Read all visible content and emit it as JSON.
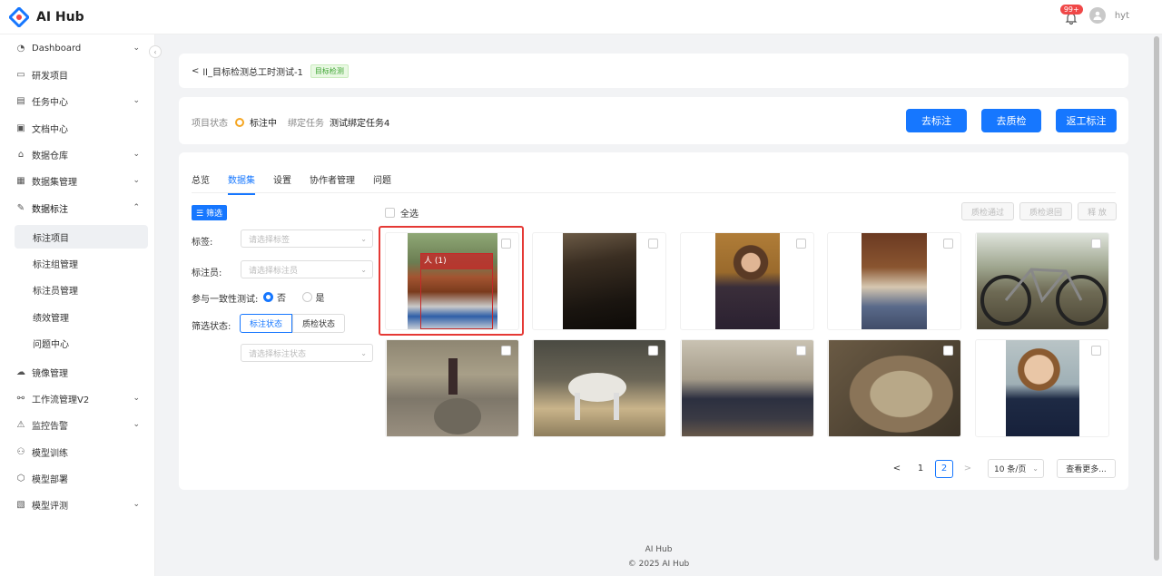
{
  "app": {
    "name": "AI Hub",
    "notif_count": "99+",
    "user": "hyt"
  },
  "sidebar": {
    "items": [
      {
        "label": "Dashboard",
        "icon": "dashboard-icon",
        "chevron": "⌄"
      },
      {
        "label": "研发项目",
        "icon": "folder-icon",
        "chevron": ""
      },
      {
        "label": "任务中心",
        "icon": "task-icon",
        "chevron": "⌄"
      },
      {
        "label": "文档中心",
        "icon": "document-icon",
        "chevron": ""
      },
      {
        "label": "数据仓库",
        "icon": "home-icon",
        "chevron": "⌄"
      },
      {
        "label": "数据集管理",
        "icon": "dataset-icon",
        "chevron": "⌄"
      },
      {
        "label": "数据标注",
        "icon": "pen-icon",
        "chevron": "⌃"
      }
    ],
    "sub_items": [
      "标注项目",
      "标注组管理",
      "标注员管理",
      "绩效管理",
      "问题中心"
    ],
    "items2": [
      {
        "label": "镜像管理",
        "icon": "image-icon",
        "chevron": ""
      },
      {
        "label": "工作流管理V2",
        "icon": "workflow-icon",
        "chevron": "⌄"
      },
      {
        "label": "监控告警",
        "icon": "warning-icon",
        "chevron": "⌄"
      },
      {
        "label": "模型训练",
        "icon": "train-icon",
        "chevron": ""
      },
      {
        "label": "模型部署",
        "icon": "deploy-icon",
        "chevron": ""
      },
      {
        "label": "模型评测",
        "icon": "eval-icon",
        "chevron": "⌄"
      }
    ]
  },
  "breadcrumb": {
    "back": "<",
    "title": "ll_目标检测总工时测试-1",
    "tag": "目标检测"
  },
  "status": {
    "label1": "项目状态",
    "value1": "标注中",
    "label2": "绑定任务",
    "value2": "测试绑定任务4",
    "btn_annotate": "去标注",
    "btn_qc": "去质检",
    "btn_rework": "返工标注"
  },
  "tabs": [
    "总览",
    "数据集",
    "设置",
    "协作者管理",
    "问题"
  ],
  "filter": {
    "tag": "筛选",
    "label_tags": "标签:",
    "ph_tags": "请选择标签",
    "label_annotator": "标注员:",
    "ph_annotator": "请选择标注员",
    "label_consistency": "参与一致性测试:",
    "opt_no": "否",
    "opt_yes": "是",
    "label_status": "筛选状态:",
    "seg_annot": "标注状态",
    "seg_qc": "质检状态",
    "ph_status": "请选择标注状态"
  },
  "toolbar": {
    "select_all": "全选",
    "qc_pass": "质检通过",
    "qc_reject": "质检退回",
    "release": "释 放"
  },
  "thumbs": [
    {
      "name": "horse-jump",
      "label": "人 (1)"
    },
    {
      "name": "dark-water"
    },
    {
      "name": "woman-talking"
    },
    {
      "name": "two-girls"
    },
    {
      "name": "bicycle"
    },
    {
      "name": "well-person"
    },
    {
      "name": "white-horse"
    },
    {
      "name": "living-room"
    },
    {
      "name": "tabby-cat"
    },
    {
      "name": "boy-thumbsup"
    }
  ],
  "pagination": {
    "prev": "<",
    "p1": "1",
    "p2": "2",
    "next": ">",
    "size": "10 条/页",
    "more": "查看更多..."
  },
  "footer": {
    "line1": "AI Hub",
    "line2": "© 2025 AI Hub"
  }
}
